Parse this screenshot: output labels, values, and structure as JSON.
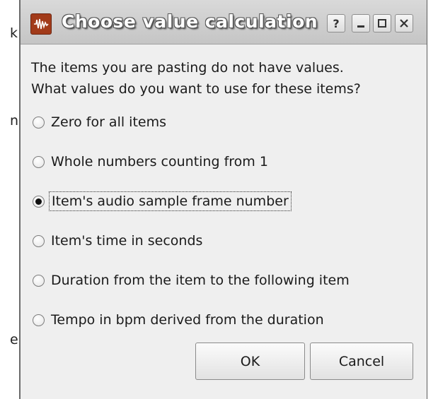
{
  "background": {
    "fragments": [
      "k",
      "n",
      "e"
    ]
  },
  "dialog": {
    "title": "Choose value calculation",
    "app_icon": "waveform-icon",
    "titlebar_buttons": {
      "help": "?",
      "minimize": "–",
      "maximize": "□",
      "close": "×"
    },
    "prompt_line1": "The items you are pasting do not have values.",
    "prompt_line2": "What values do you want to use for these items?",
    "options": [
      {
        "label": "Zero for all items",
        "checked": false
      },
      {
        "label": "Whole numbers counting from 1",
        "checked": false
      },
      {
        "label": "Item's audio sample frame number",
        "checked": true
      },
      {
        "label": "Item's time in seconds",
        "checked": false
      },
      {
        "label": "Duration from the item to the following item",
        "checked": false
      },
      {
        "label": "Tempo in bpm derived from the duration",
        "checked": false
      }
    ],
    "ok_label": "OK",
    "cancel_label": "Cancel"
  },
  "colors": {
    "dialog_bg": "#efefef",
    "titlebar": "#c5c5c5",
    "app_icon": "#a23b1a"
  }
}
